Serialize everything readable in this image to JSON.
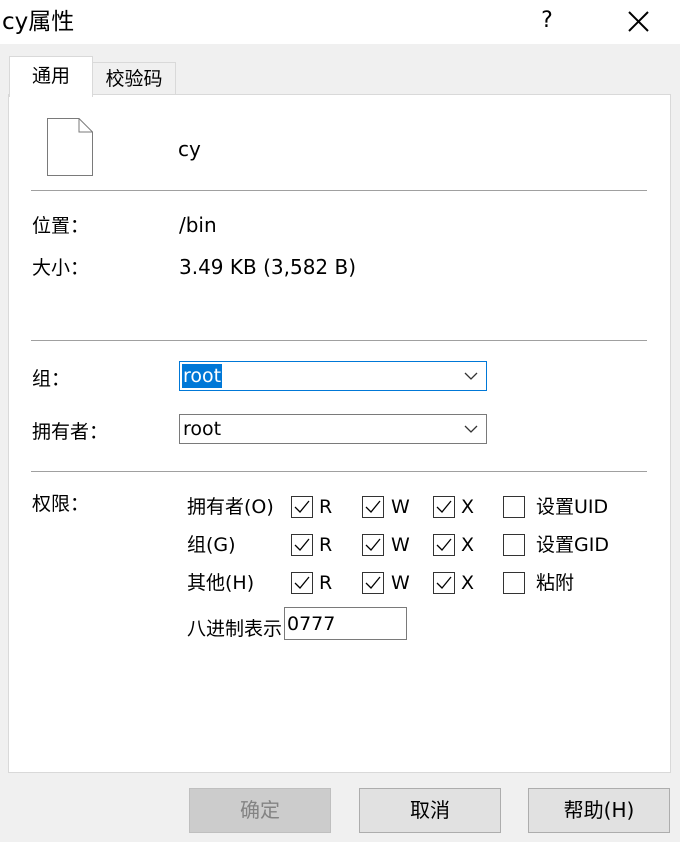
{
  "window": {
    "title": "cy属性",
    "help_label": "?"
  },
  "tabs": [
    {
      "label": "通用",
      "active": true
    },
    {
      "label": "校验码",
      "active": false
    }
  ],
  "file": {
    "name": "cy",
    "icon": "document-icon",
    "location_label": "位置：",
    "location_value": "/bin",
    "size_label": "大小：",
    "size_value": "3.49 KB (3,582 B)"
  },
  "ownership": {
    "group_label": "组：",
    "group_value": "root",
    "owner_label": "拥有者：",
    "owner_value": "root"
  },
  "permissions": {
    "label": "权限：",
    "rows": [
      {
        "name": "拥有者(O)",
        "r": true,
        "w": true,
        "x": true,
        "special_label": "设置UID",
        "special": false
      },
      {
        "name": "组(G)",
        "r": true,
        "w": true,
        "x": true,
        "special_label": "设置GID",
        "special": false
      },
      {
        "name": "其他(H)",
        "r": true,
        "w": true,
        "x": true,
        "special_label": "粘附",
        "special": false
      }
    ],
    "r_label": "R",
    "w_label": "W",
    "x_label": "X",
    "octal_label": "八进制表示",
    "octal_value": "0777"
  },
  "buttons": {
    "ok": "确定",
    "cancel": "取消",
    "help": "帮助(H)"
  },
  "colors": {
    "accent": "#0078d7",
    "panel": "#ffffff",
    "background": "#f0f0f0"
  }
}
